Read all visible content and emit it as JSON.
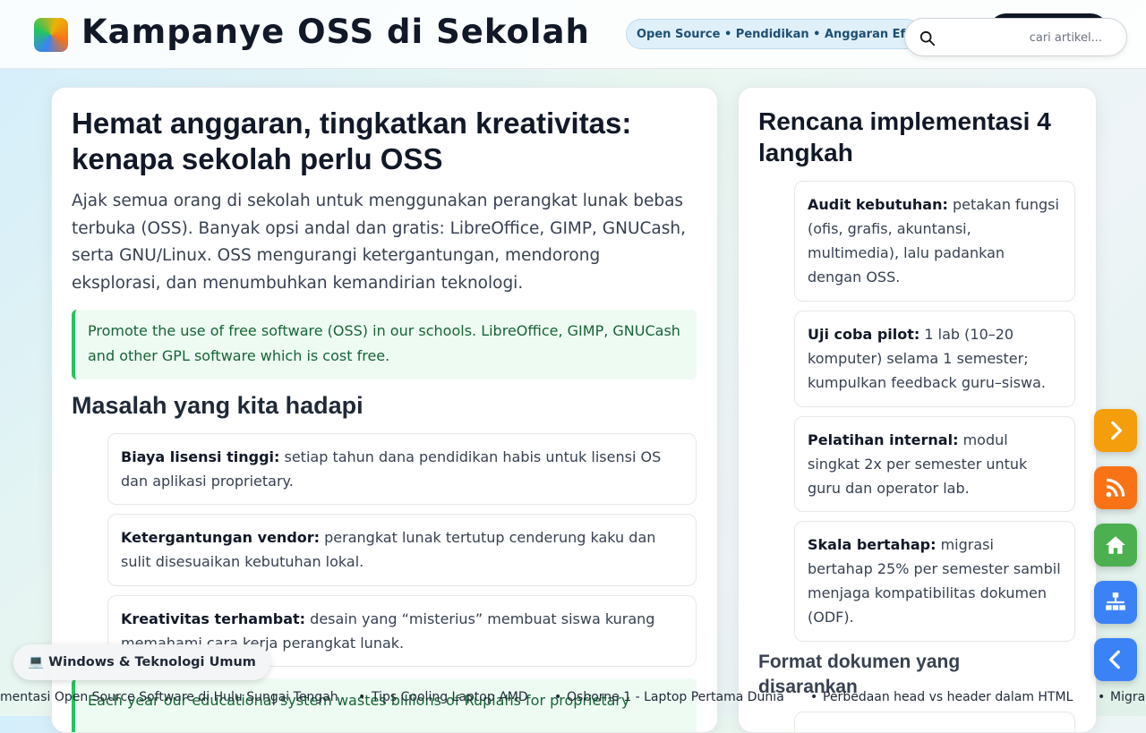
{
  "header": {
    "title": "Kampanye OSS di Sekolah",
    "tagline": "Open Source • Pendidikan • Anggaran Efektif",
    "search_placeholder": "cari artikel..."
  },
  "article": {
    "title": "Hemat anggaran, tingkatkan kreativitas: kenapa sekolah perlu OSS",
    "lead": "Ajak semua orang di sekolah untuk menggunakan perangkat lunak bebas terbuka (OSS). Banyak opsi andal dan gratis: LibreOffice, GIMP, GNUCash, serta GNU/Linux. OSS mengurangi ketergantungan, mendorong eksplorasi, dan menumbuhkan kemandirian teknologi.",
    "quote": "Promote the use of free software (OSS) in our schools. LibreOffice, GIMP, GNUCash and other GPL software which is cost free.",
    "problems_heading": "Masalah yang kita hadapi",
    "problems": [
      {
        "term": "Biaya lisensi tinggi:",
        "text": " setiap tahun dana pendidikan habis untuk lisensi OS dan aplikasi proprietary."
      },
      {
        "term": "Ketergantungan vendor:",
        "text": " perangkat lunak tertutup cenderung kaku dan sulit disesuaikan kebutuhan lokal."
      },
      {
        "term": "Kreativitas terhambat:",
        "text": " desain yang “misterius” membuat siswa kurang memahami cara kerja perangkat lunak."
      }
    ],
    "quote2": "Each year our educational system wastes billions of Rupiahs for proprietary"
  },
  "sidebar": {
    "heading": "Rencana implementasi 4 langkah",
    "steps": [
      {
        "term": "Audit kebutuhan:",
        "text": " petakan fungsi (ofis, grafis, akuntansi, multimedia), lalu padankan dengan OSS."
      },
      {
        "term": "Uji coba pilot:",
        "text": " 1 lab (10–20 komputer) selama 1 semester; kumpulkan feedback guru–siswa."
      },
      {
        "term": "Pelatihan internal:",
        "text": " modul singkat 2x per semester untuk guru dan operator lab."
      },
      {
        "term": "Skala bertahap:",
        "text": " migrasi bertahap 25% per semester sambil menjaga kompatibilitas dokumen (ODF)."
      }
    ],
    "format_heading": "Format dokumen yang disarankan"
  },
  "category_pill": {
    "icon": "💻",
    "label": "Windows & Teknologi Umum"
  },
  "ticker": [
    "mentasi Open Source Software di Hulu Sungai Tengah",
    "Tips Cooling Laptop AMD",
    "Osborne 1 - Laptop Pertama Dunia",
    "Perbedaan head vs header dalam HTML",
    "Migras"
  ],
  "fabs": [
    {
      "icon": "chevron-right-icon",
      "color": "#f59e0b"
    },
    {
      "icon": "rss-icon",
      "color": "#f97316"
    },
    {
      "icon": "home-icon",
      "color": "#4caf50"
    },
    {
      "icon": "sitemap-icon",
      "color": "#3b82f6"
    },
    {
      "icon": "chevron-left-icon",
      "color": "#3b82f6"
    }
  ]
}
